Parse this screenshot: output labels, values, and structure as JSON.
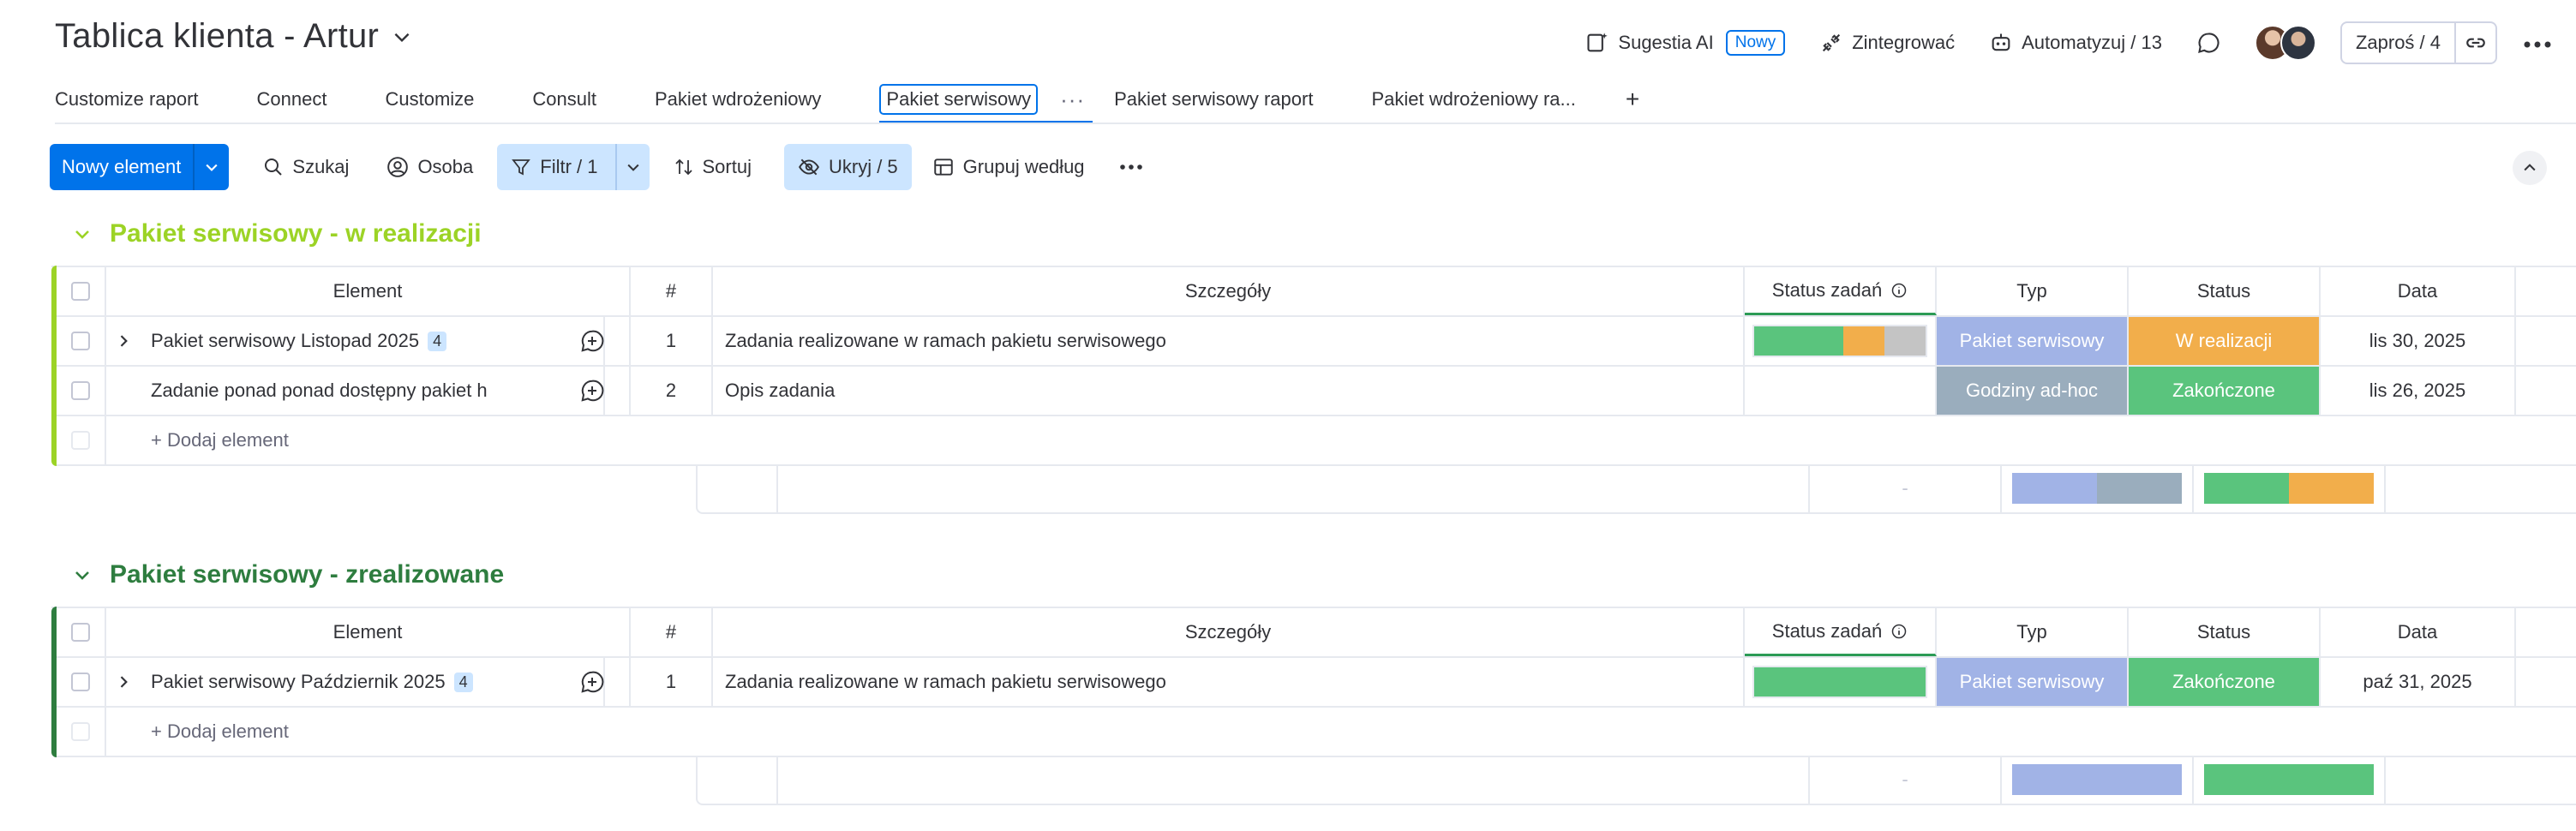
{
  "header": {
    "title": "Tablica klienta - Artur",
    "sugestia": "Sugestia AI",
    "nowy_badge": "Nowy",
    "integrate": "Zintegrować",
    "automate": "Automatyzuj / 13",
    "invite": "Zaproś / 4"
  },
  "tabs": [
    {
      "label": "Customize raport"
    },
    {
      "label": "Connect"
    },
    {
      "label": "Customize"
    },
    {
      "label": "Consult"
    },
    {
      "label": "Pakiet wdrożeniowy"
    },
    {
      "label": "Pakiet serwisowy"
    },
    {
      "label": "Pakiet serwisowy raport"
    },
    {
      "label": "Pakiet wdrożeniowy ra..."
    }
  ],
  "toolbar": {
    "new_item": "Nowy element",
    "search": "Szukaj",
    "person": "Osoba",
    "filter": "Filtr / 1",
    "sort": "Sortuj",
    "hide": "Ukryj / 5",
    "group_by": "Grupuj według"
  },
  "columns": {
    "element": "Element",
    "num": "#",
    "details": "Szczegóły",
    "task_status": "Status zadań",
    "type": "Typ",
    "status": "Status",
    "date": "Data"
  },
  "groups": [
    {
      "title": "Pakiet serwisowy - w realizacji",
      "color": "#9cd326",
      "add_label": "+ Dodaj element",
      "rows": [
        {
          "name": "Pakiet serwisowy Listopad 2025",
          "subitems": "4",
          "num": "1",
          "details": "Zadania realizowane w ramach pakietu serwisowego",
          "type": "Pakiet serwisowy",
          "type_color": "#a1b3e6",
          "status": "W realizacji",
          "status_color": "#f2ae4b",
          "date": "lis 30, 2025"
        },
        {
          "name": "Zadanie ponad ponad dostępny pakiet h",
          "num": "2",
          "details": "Opis zadania",
          "type": "Godziny ad-hoc",
          "type_color": "#9aadbd",
          "status": "Zakończone",
          "status_color": "#5ac47d",
          "date": "lis 26, 2025"
        }
      ],
      "summary_dash": "-"
    },
    {
      "title": "Pakiet serwisowy - zrealizowane",
      "color": "#2e7d3f",
      "add_label": "+ Dodaj element",
      "rows": [
        {
          "name": "Pakiet serwisowy Październik 2025",
          "subitems": "4",
          "num": "1",
          "details": "Zadania realizowane w ramach pakietu serwisowego",
          "type": "Pakiet serwisowy",
          "type_color": "#a1b3e6",
          "status": "Zakończone",
          "status_color": "#5ac47d",
          "date": "paź 31, 2025"
        }
      ],
      "summary_dash": "-"
    }
  ]
}
